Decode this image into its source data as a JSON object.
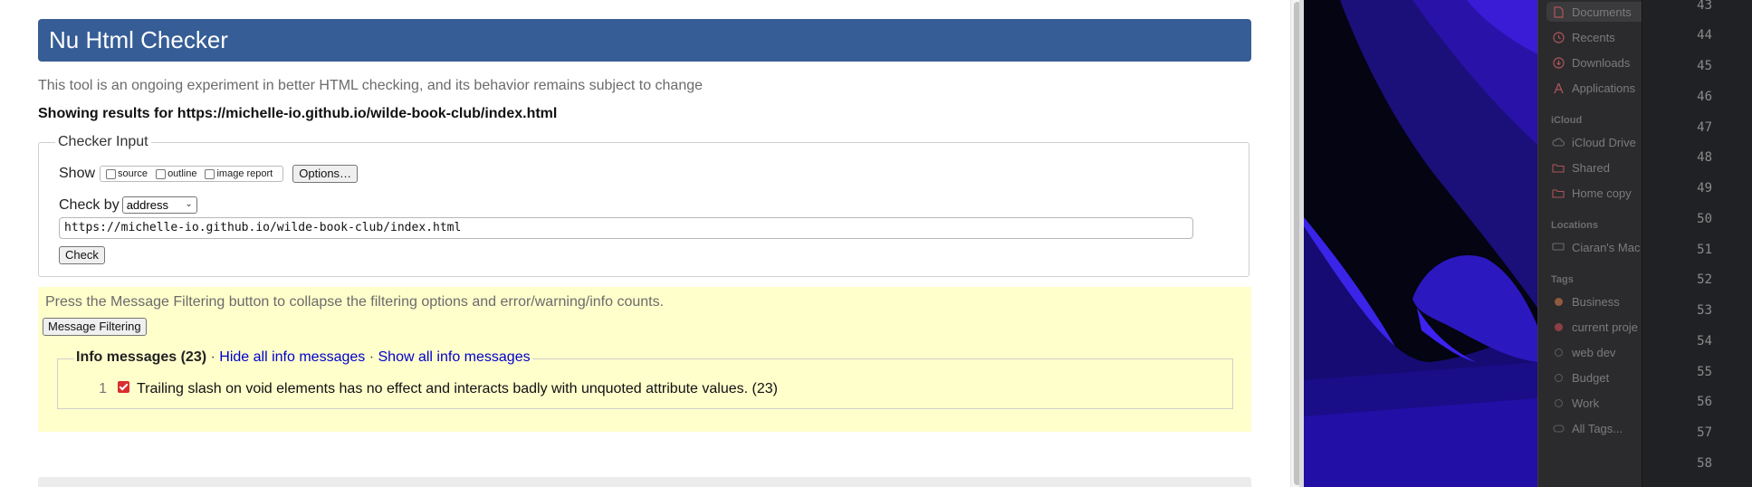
{
  "header": {
    "title": "Nu Html Checker"
  },
  "tagline": "This tool is an ongoing experiment in better HTML checking, and its behavior remains subject to change",
  "results_for": "Showing results for https://michelle-io.github.io/wilde-book-club/index.html",
  "checker_input": {
    "legend": "Checker Input",
    "show_label": "Show",
    "show_options": [
      "source",
      "outline",
      "image report"
    ],
    "options_button": "Options…",
    "check_by_label": "Check by",
    "check_by_value": "address",
    "url_value": "https://michelle-io.github.io/wilde-book-club/index.html",
    "check_button": "Check"
  },
  "filtering": {
    "instructions": "Press the Message Filtering button to collapse the filtering options and error/warning/info counts.",
    "button": "Message Filtering"
  },
  "info": {
    "title": "Info messages (23)",
    "separator": "·",
    "hide_link": "Hide all info messages",
    "show_link": "Show all info messages",
    "message_number": "1",
    "message_text": "Trailing slash on void elements has no effect and interacts badly with unquoted attribute values. (23)"
  },
  "finder_sidebar": {
    "items_top": [
      "Documents",
      "Recents",
      "Downloads",
      "Applications"
    ],
    "icloud_heading": "iCloud",
    "icloud_items": [
      "iCloud Drive",
      "Shared",
      "Home copy"
    ],
    "locations_heading": "Locations",
    "locations_items": [
      "Ciaran's Mac"
    ],
    "tags_heading": "Tags",
    "tags": [
      {
        "label": "Business",
        "color": "#8f5a3f"
      },
      {
        "label": "current proje",
        "color": "#8d3e44"
      },
      {
        "label": "web dev",
        "color": ""
      },
      {
        "label": "Budget",
        "color": ""
      },
      {
        "label": "Work",
        "color": ""
      },
      {
        "label": "All Tags...",
        "color": ""
      }
    ]
  },
  "line_numbers": [
    "43",
    "44",
    "45",
    "46",
    "47",
    "48",
    "49",
    "50",
    "51",
    "52",
    "53",
    "54",
    "55",
    "56",
    "57",
    "58"
  ],
  "colors": {
    "header_bg": "#365d95",
    "message_panel_bg": "#ffffcc",
    "link": "#0000cc"
  }
}
